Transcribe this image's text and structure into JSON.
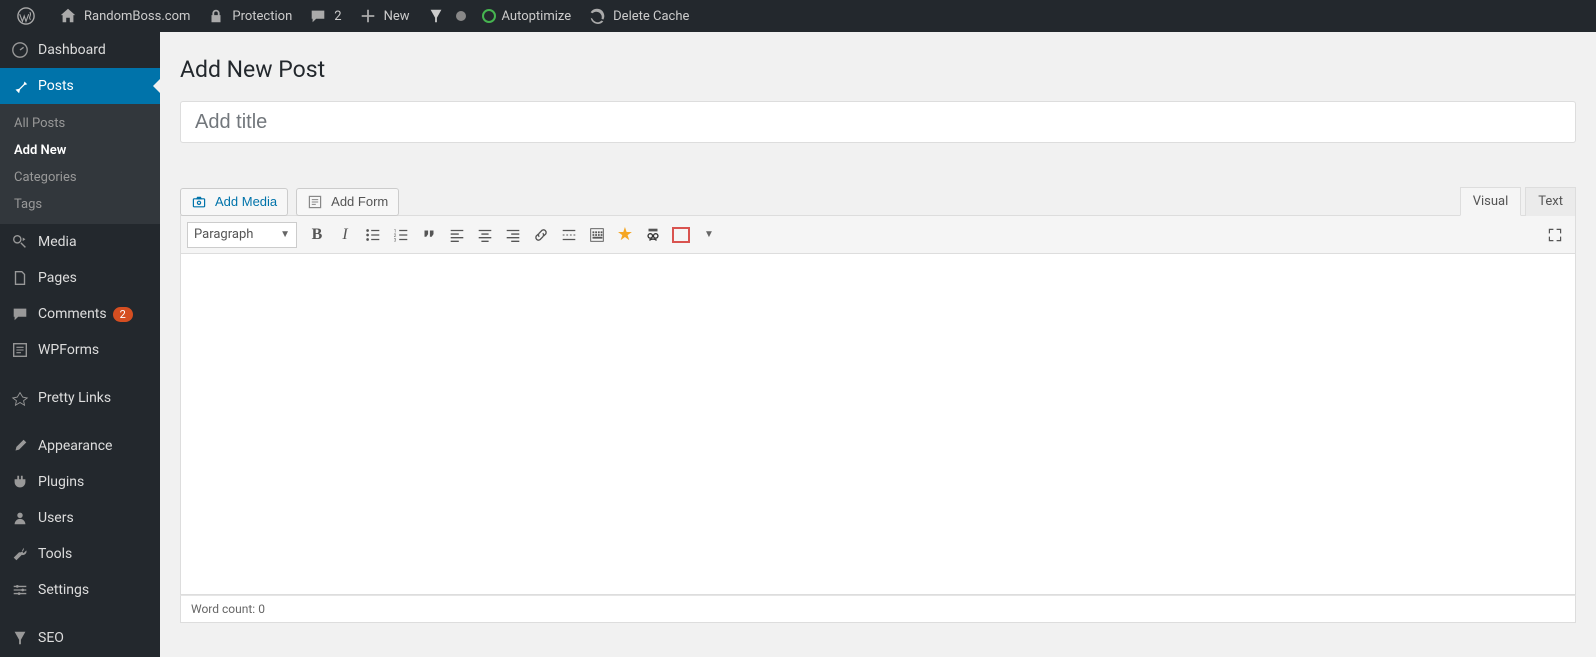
{
  "adminbar": {
    "site_name": "RandomBoss.com",
    "protection": "Protection",
    "comments_count": "2",
    "new_label": "New",
    "autoptimize": "Autoptimize",
    "delete_cache": "Delete Cache"
  },
  "sidebar": {
    "dashboard": "Dashboard",
    "posts": "Posts",
    "posts_sub": {
      "all": "All Posts",
      "add_new": "Add New",
      "categories": "Categories",
      "tags": "Tags"
    },
    "media": "Media",
    "pages": "Pages",
    "comments": "Comments",
    "comments_badge": "2",
    "wpforms": "WPForms",
    "pretty_links": "Pretty Links",
    "appearance": "Appearance",
    "plugins": "Plugins",
    "users": "Users",
    "tools": "Tools",
    "settings": "Settings",
    "seo": "SEO"
  },
  "main": {
    "page_title": "Add New Post",
    "title_placeholder": "Add title",
    "add_media": "Add Media",
    "add_form": "Add Form",
    "tabs": {
      "visual": "Visual",
      "text": "Text"
    },
    "format_dropdown": "Paragraph",
    "word_count_label": "Word count:",
    "word_count_value": "0"
  }
}
